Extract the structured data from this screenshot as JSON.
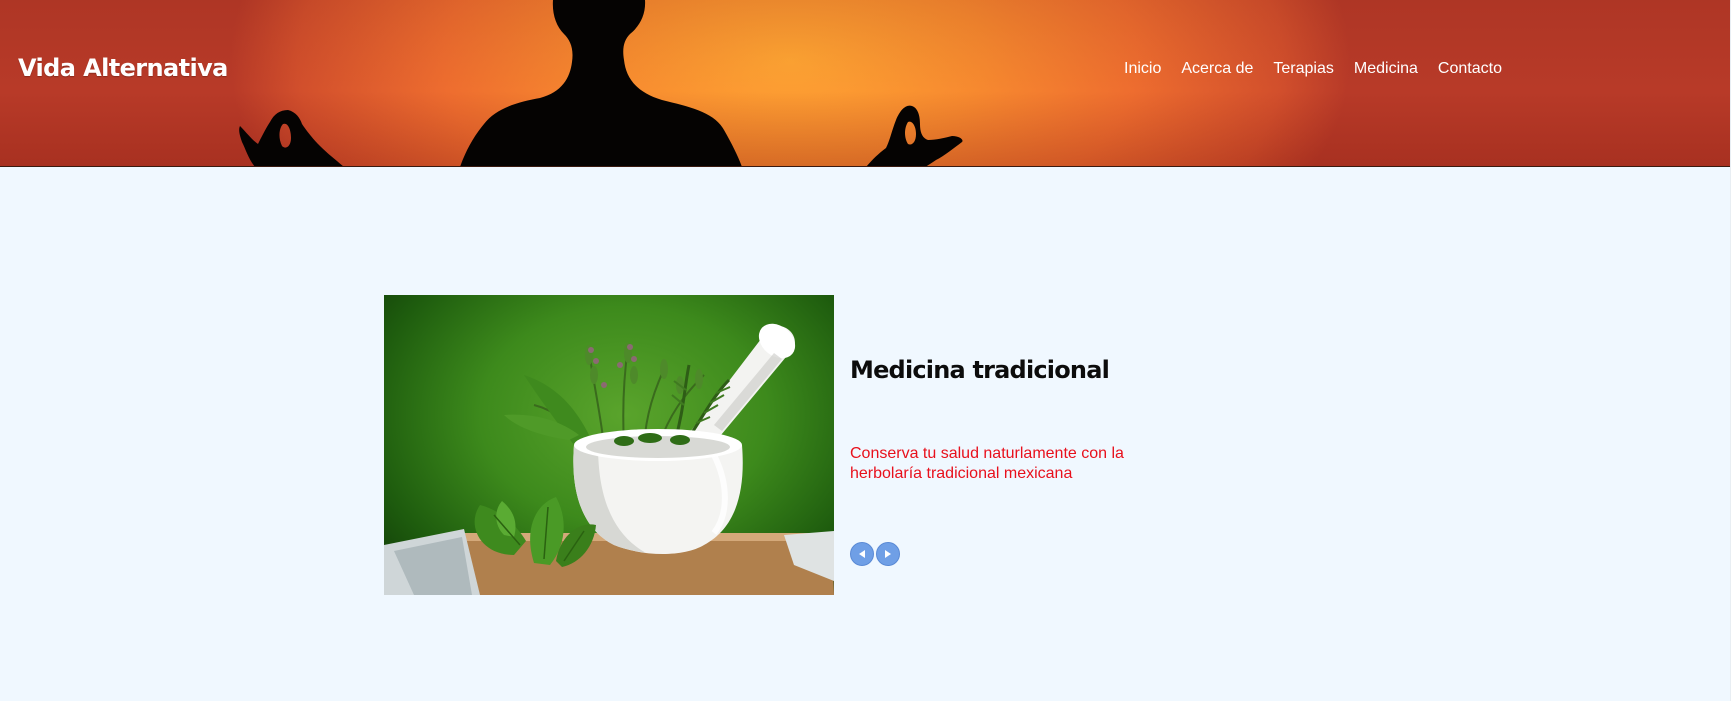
{
  "site": {
    "brand": "Vida Alternativa"
  },
  "nav": {
    "items": [
      {
        "label": "Inicio"
      },
      {
        "label": "Acerca de"
      },
      {
        "label": "Terapias"
      },
      {
        "label": "Medicina"
      },
      {
        "label": "Contacto"
      }
    ]
  },
  "slider": {
    "image_icon": "herbs-mortar-image",
    "title": "Medicina tradicional",
    "description": "Conserva tu salud naturlamente con la herbolaría tradicional mexicana",
    "prev_icon": "chevron-left-icon",
    "next_icon": "chevron-right-icon"
  },
  "colors": {
    "page_background": "#f0f8ff",
    "header_gradient_center": "#ffa533",
    "header_gradient_edge": "#b83a28",
    "description_text": "#e8101c",
    "control_button": "#6f9fe6"
  }
}
